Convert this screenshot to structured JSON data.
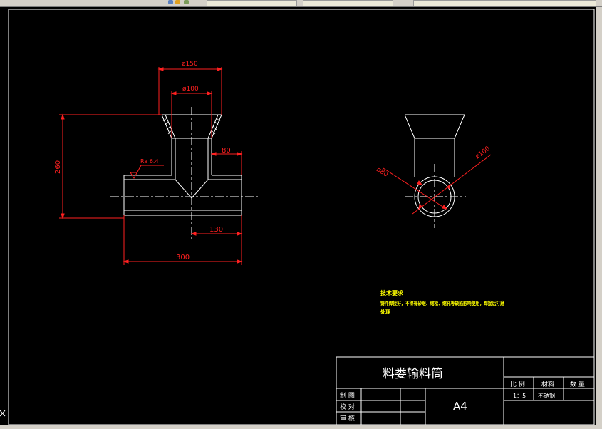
{
  "dimensions": {
    "d150": "ø150",
    "d100": "ø100",
    "h260": "260",
    "w80": "80",
    "w130": "130",
    "w300": "300",
    "d80": "ø80",
    "d100_side": "ø100",
    "roughness": "Ra 6.4"
  },
  "tech_requirements": {
    "heading": "技术要求",
    "line1": "铸件焊接好，不得有砂眼、缩松、缩孔等缺陷影响使用，焊接后打磨",
    "line2": "处理"
  },
  "title_block": {
    "title": "料娄输料筒",
    "col_ratio": "比 例",
    "col_material": "材料",
    "col_qty": "数 量",
    "val_ratio": "1：5",
    "val_material": "不锈钢",
    "row_draw": "制 图",
    "row_check": "校 对",
    "row_review": "审 核",
    "sheet_size": "A4"
  },
  "colors": {
    "background": "#000000",
    "geometry": "#ffffff",
    "dimension": "#ff2020",
    "notes": "#ffff00"
  }
}
